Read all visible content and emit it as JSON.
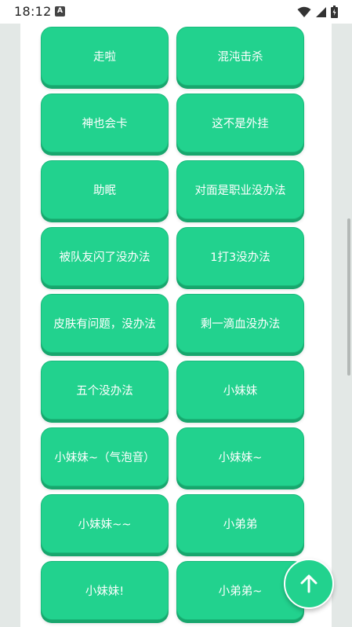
{
  "status_bar": {
    "time": "18:12",
    "notification_icon": "A",
    "icons": [
      "wifi-icon",
      "signal-icon",
      "battery-icon"
    ]
  },
  "buttons": [
    "走啦",
    "混沌击杀",
    "神也会卡",
    "这不是外挂",
    "助眠",
    "对面是职业没办法",
    "被队友闪了没办法",
    "1打3没办法",
    "皮肤有问题，没办法",
    "剩一滴血没办法",
    "五个没办法",
    "小妹妹",
    "小妹妹~（气泡音）",
    "小妹妹~",
    "小妹妹~~",
    "小弟弟",
    "小妹妹!",
    "小弟弟~"
  ],
  "fab": {
    "icon": "arrow-up-icon"
  },
  "colors": {
    "accent": "#22d28e",
    "accent_shadow": "#18a66d",
    "background": "#e3e8e6"
  }
}
